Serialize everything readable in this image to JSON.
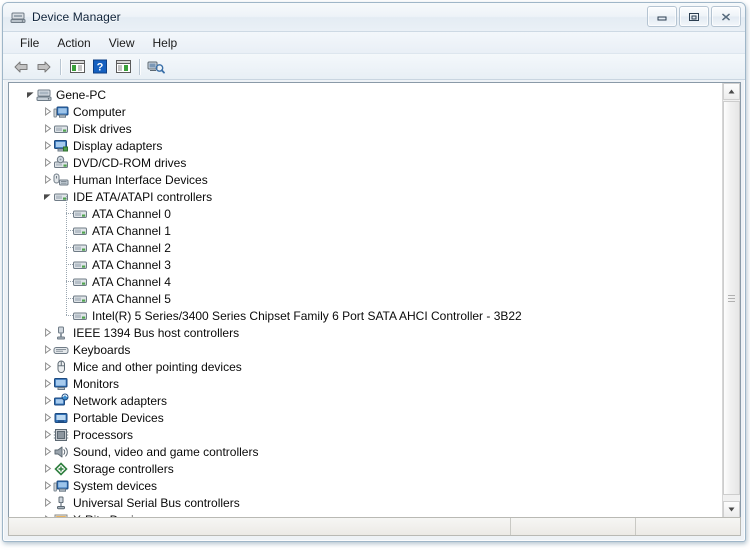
{
  "window": {
    "title": "Device Manager",
    "icon": "device-manager-icon",
    "caption_buttons": [
      {
        "name": "minimize-button",
        "glyph": "minimize"
      },
      {
        "name": "restore-button",
        "glyph": "restore"
      },
      {
        "name": "close-button",
        "glyph": "close"
      }
    ]
  },
  "menu": {
    "items": [
      {
        "label": "File"
      },
      {
        "label": "Action"
      },
      {
        "label": "View"
      },
      {
        "label": "Help"
      }
    ]
  },
  "toolbar": {
    "buttons": [
      {
        "name": "back-button",
        "icon": "back-arrow-icon"
      },
      {
        "name": "forward-button",
        "icon": "forward-arrow-icon"
      },
      {
        "name": "separator-1",
        "icon": "separator"
      },
      {
        "name": "show-hide-console-tree-button",
        "icon": "console-tree-icon"
      },
      {
        "name": "help-button",
        "icon": "help-question-icon"
      },
      {
        "name": "properties-button",
        "icon": "properties-icon"
      },
      {
        "name": "separator-2",
        "icon": "separator"
      },
      {
        "name": "scan-for-hardware-changes-button",
        "icon": "scan-hardware-icon"
      }
    ]
  },
  "tree": {
    "nodes": [
      {
        "label": "Gene-PC",
        "depth": 0,
        "state": "expanded",
        "icon": "computer-root-icon"
      },
      {
        "label": "Computer",
        "depth": 1,
        "state": "collapsed",
        "icon": "computer-icon"
      },
      {
        "label": "Disk drives",
        "depth": 1,
        "state": "collapsed",
        "icon": "disk-drive-icon"
      },
      {
        "label": "Display adapters",
        "depth": 1,
        "state": "collapsed",
        "icon": "display-adapter-icon"
      },
      {
        "label": "DVD/CD-ROM drives",
        "depth": 1,
        "state": "collapsed",
        "icon": "dvd-drive-icon"
      },
      {
        "label": "Human Interface Devices",
        "depth": 1,
        "state": "collapsed",
        "icon": "hid-icon"
      },
      {
        "label": "IDE ATA/ATAPI controllers",
        "depth": 1,
        "state": "expanded",
        "icon": "ide-controller-icon"
      },
      {
        "label": "ATA Channel 0",
        "depth": 2,
        "state": "leaf",
        "icon": "ata-channel-icon"
      },
      {
        "label": "ATA Channel 1",
        "depth": 2,
        "state": "leaf",
        "icon": "ata-channel-icon"
      },
      {
        "label": "ATA Channel 2",
        "depth": 2,
        "state": "leaf",
        "icon": "ata-channel-icon"
      },
      {
        "label": "ATA Channel 3",
        "depth": 2,
        "state": "leaf",
        "icon": "ata-channel-icon"
      },
      {
        "label": "ATA Channel 4",
        "depth": 2,
        "state": "leaf",
        "icon": "ata-channel-icon"
      },
      {
        "label": "ATA Channel 5",
        "depth": 2,
        "state": "leaf",
        "icon": "ata-channel-icon"
      },
      {
        "label": "Intel(R) 5 Series/3400 Series Chipset Family 6 Port SATA AHCI Controller - 3B22",
        "depth": 2,
        "state": "leaf",
        "icon": "ata-channel-icon"
      },
      {
        "label": "IEEE 1394 Bus host controllers",
        "depth": 1,
        "state": "collapsed",
        "icon": "ieee1394-icon"
      },
      {
        "label": "Keyboards",
        "depth": 1,
        "state": "collapsed",
        "icon": "keyboard-icon"
      },
      {
        "label": "Mice and other pointing devices",
        "depth": 1,
        "state": "collapsed",
        "icon": "mouse-icon"
      },
      {
        "label": "Monitors",
        "depth": 1,
        "state": "collapsed",
        "icon": "monitor-icon"
      },
      {
        "label": "Network adapters",
        "depth": 1,
        "state": "collapsed",
        "icon": "network-adapter-icon"
      },
      {
        "label": "Portable Devices",
        "depth": 1,
        "state": "collapsed",
        "icon": "portable-device-icon"
      },
      {
        "label": "Processors",
        "depth": 1,
        "state": "collapsed",
        "icon": "processor-icon"
      },
      {
        "label": "Sound, video and game controllers",
        "depth": 1,
        "state": "collapsed",
        "icon": "sound-icon"
      },
      {
        "label": "Storage controllers",
        "depth": 1,
        "state": "collapsed",
        "icon": "storage-controller-icon"
      },
      {
        "label": "System devices",
        "depth": 1,
        "state": "collapsed",
        "icon": "system-device-icon"
      },
      {
        "label": "Universal Serial Bus controllers",
        "depth": 1,
        "state": "collapsed",
        "icon": "usb-controller-icon"
      },
      {
        "label": "X-Rite Devices",
        "depth": 1,
        "state": "collapsed",
        "icon": "xrite-device-icon"
      }
    ]
  },
  "scrollbar": {
    "up_icon": "scroll-up-arrow-icon",
    "down_icon": "scroll-down-arrow-icon",
    "grip_icon": "scrollbar-grip-icon"
  },
  "statusbar": {
    "main": "",
    "secondary": "",
    "tertiary": ""
  }
}
